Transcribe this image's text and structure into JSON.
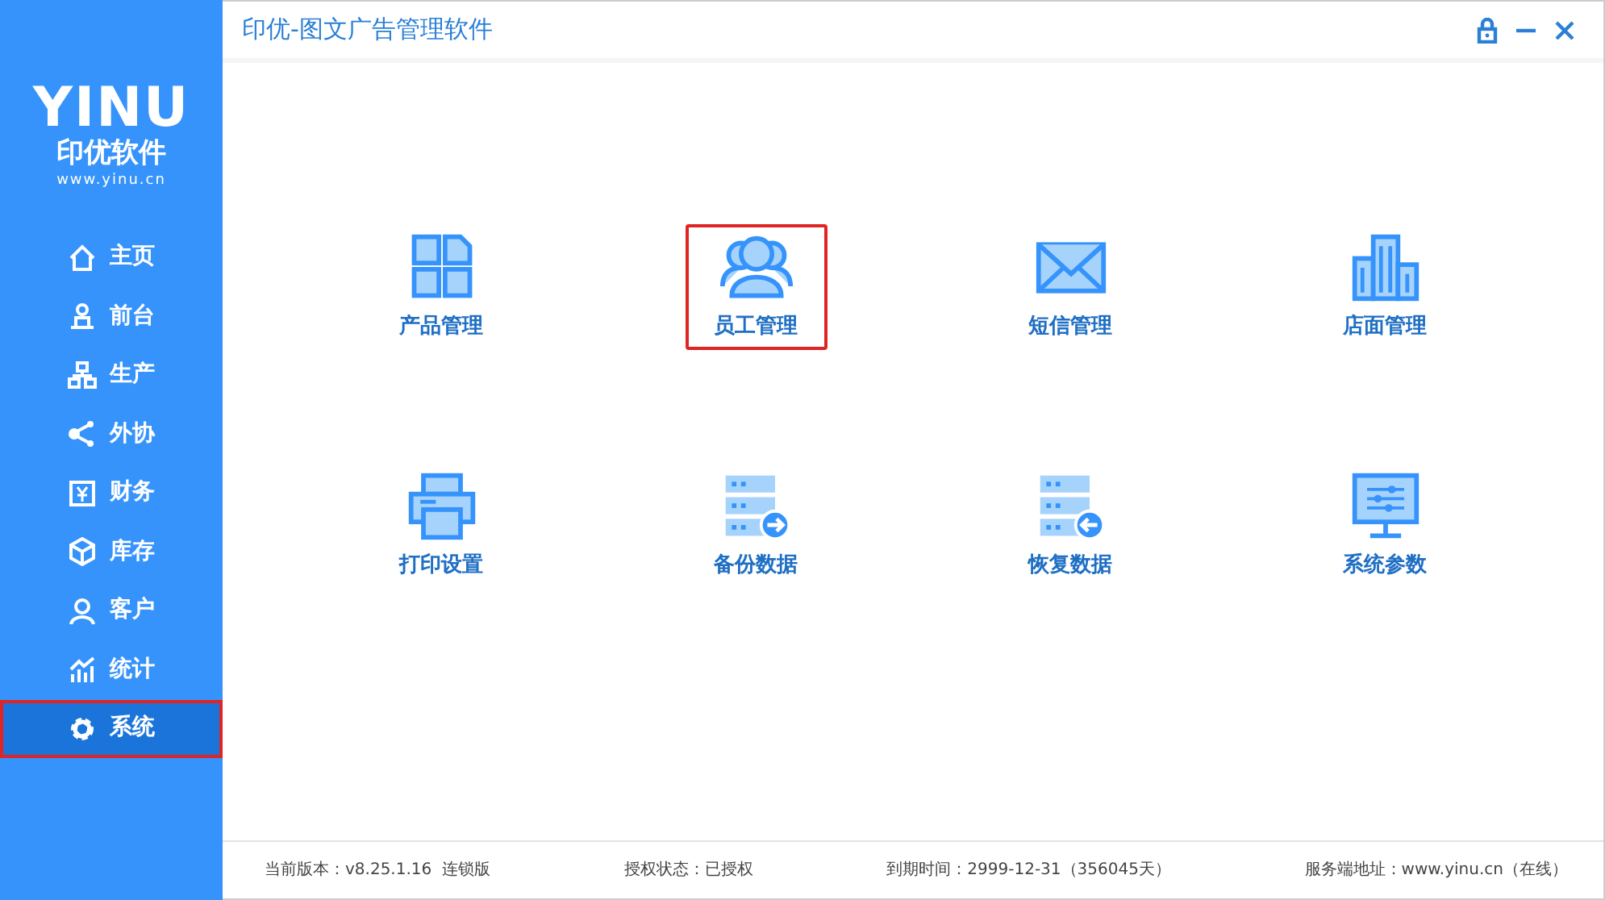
{
  "logo": {
    "mark": "YINU",
    "name": "印优软件",
    "url": "www.yinu.cn"
  },
  "sidebar": {
    "items": [
      {
        "kind": "home",
        "label": "主页",
        "selected": false
      },
      {
        "kind": "desk",
        "label": "前台",
        "selected": false
      },
      {
        "kind": "org",
        "label": "生产",
        "selected": false
      },
      {
        "kind": "share",
        "label": "外协",
        "selected": false
      },
      {
        "kind": "yen",
        "label": "财务",
        "selected": false
      },
      {
        "kind": "box",
        "label": "库存",
        "selected": false
      },
      {
        "kind": "user",
        "label": "客户",
        "selected": false
      },
      {
        "kind": "chart",
        "label": "统计",
        "selected": false
      },
      {
        "kind": "gear",
        "label": "系统",
        "selected": true
      }
    ]
  },
  "window": {
    "title": "印优-图文广告管理软件"
  },
  "tiles": [
    {
      "kind": "grid",
      "label": "产品管理",
      "selected": false
    },
    {
      "kind": "people",
      "label": "员工管理",
      "selected": true
    },
    {
      "kind": "mail",
      "label": "短信管理",
      "selected": false
    },
    {
      "kind": "building",
      "label": "店面管理",
      "selected": false
    },
    {
      "kind": "printer",
      "label": "打印设置",
      "selected": false
    },
    {
      "kind": "backup",
      "label": "备份数据",
      "selected": false
    },
    {
      "kind": "restore",
      "label": "恢复数据",
      "selected": false
    },
    {
      "kind": "monitor",
      "label": "系统参数",
      "selected": false
    }
  ],
  "status_bar": [
    "当前版本：v8.25.1.16  连锁版",
    "授权状态：已授权",
    "到期时间：2999-12-31（356045天）",
    "服务端地址：www.yinu.cn（在线）"
  ]
}
